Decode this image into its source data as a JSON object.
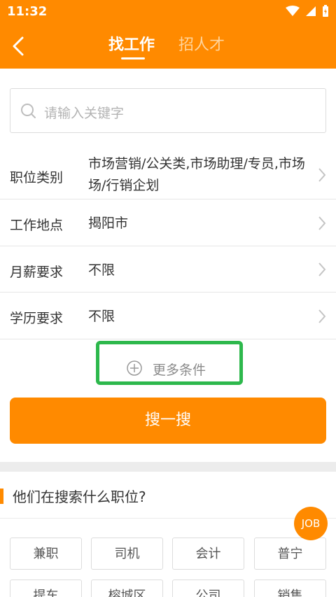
{
  "status": {
    "time": "11:32",
    "icons": [
      "wifi-icon",
      "signal-icon",
      "battery-icon"
    ]
  },
  "header": {
    "tabs": [
      {
        "label": "找工作",
        "active": true
      },
      {
        "label": "招人才",
        "active": false
      }
    ]
  },
  "search": {
    "placeholder": "请输入关键字"
  },
  "filters": [
    {
      "label": "职位类别",
      "value_line1": "市场营销/公关类,市场助理/专员,市场",
      "value_line2": "场/行销企划"
    },
    {
      "label": "工作地点",
      "value": "揭阳市"
    },
    {
      "label": "月薪要求",
      "value": "不限"
    },
    {
      "label": "学历要求",
      "value": "不限"
    }
  ],
  "more": {
    "label": "更多条件"
  },
  "search_button": {
    "label": "搜一搜"
  },
  "section": {
    "title": "他们在搜索什么职位?"
  },
  "tags": [
    "兼职",
    "司机",
    "会计",
    "普宁",
    "提车",
    "榕城区",
    "公司",
    "销售"
  ],
  "fab": {
    "label": "JOB"
  },
  "colors": {
    "accent": "#ff8a00",
    "highlight": "#2db84c"
  }
}
